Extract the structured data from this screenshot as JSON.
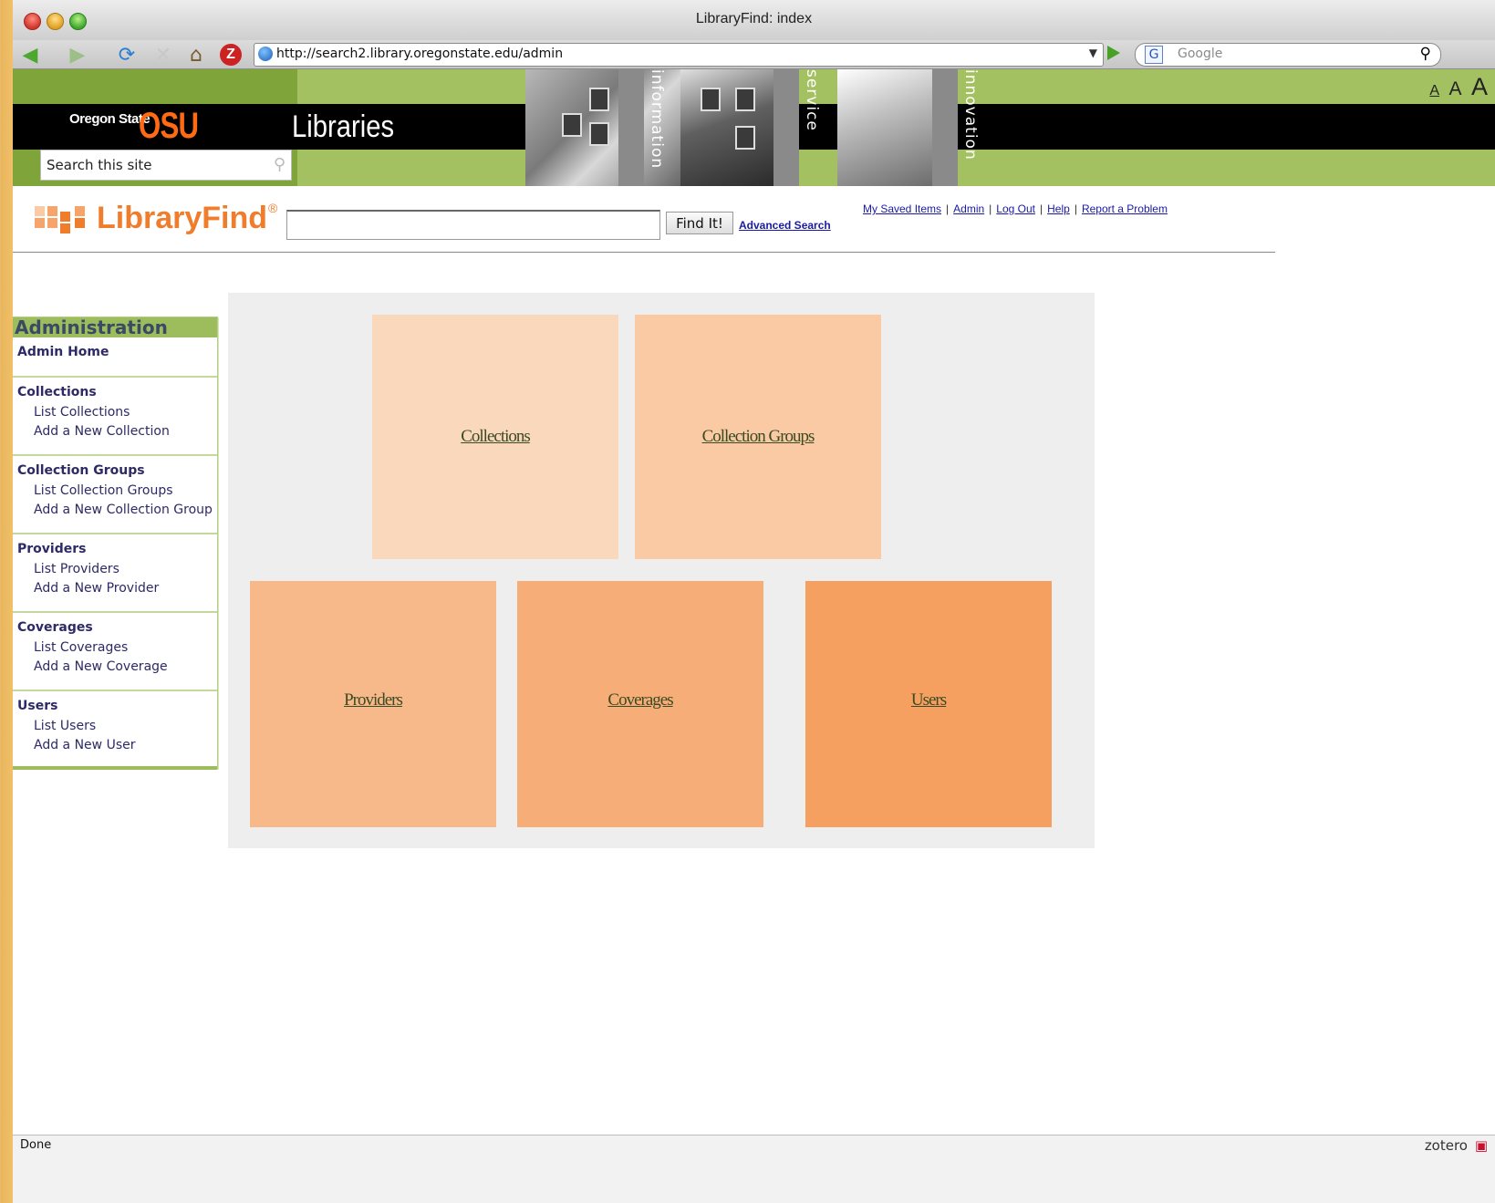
{
  "window": {
    "title": "LibraryFind: index"
  },
  "browser": {
    "url": "http://search2.library.oregonstate.edu/admin",
    "search_placeholder": "Google",
    "search_engine": "G"
  },
  "osu": {
    "logo_small": "Oregon State",
    "logo_big": "OSU",
    "libraries": "Libraries",
    "words": [
      "information",
      "service",
      "innovation"
    ],
    "size_labels": [
      "A",
      "A",
      "A"
    ],
    "site_search": "Search this site"
  },
  "libraryfind": {
    "logo_text": "LibraryFind",
    "reg": "®",
    "find_button": "Find It!",
    "advanced": "Advanced Search",
    "links": [
      "My Saved Items",
      "Admin",
      "Log Out",
      "Help",
      "Report a Problem"
    ]
  },
  "sidebar": {
    "title": "Administration",
    "home": "Admin Home",
    "sections": [
      {
        "title": "Collections",
        "items": [
          "List Collections",
          "Add a New Collection"
        ]
      },
      {
        "title": "Collection Groups",
        "items": [
          "List Collection Groups",
          "Add a New Collection Group"
        ]
      },
      {
        "title": "Providers",
        "items": [
          "List Providers",
          "Add a New Provider"
        ]
      },
      {
        "title": "Coverages",
        "items": [
          "List Coverages",
          "Add a New Coverage"
        ]
      },
      {
        "title": "Users",
        "items": [
          "List Users",
          "Add a New User"
        ]
      }
    ]
  },
  "tiles": [
    {
      "label": "Collections",
      "color": "#fad8bc"
    },
    {
      "label": "Collection Groups",
      "color": "#f9caa3"
    },
    {
      "label": "Providers",
      "color": "#f8b98a"
    },
    {
      "label": "Coverages",
      "color": "#f7ad78"
    },
    {
      "label": "Users",
      "color": "#f5a060"
    }
  ],
  "status": {
    "left": "Done",
    "right": "zotero"
  }
}
